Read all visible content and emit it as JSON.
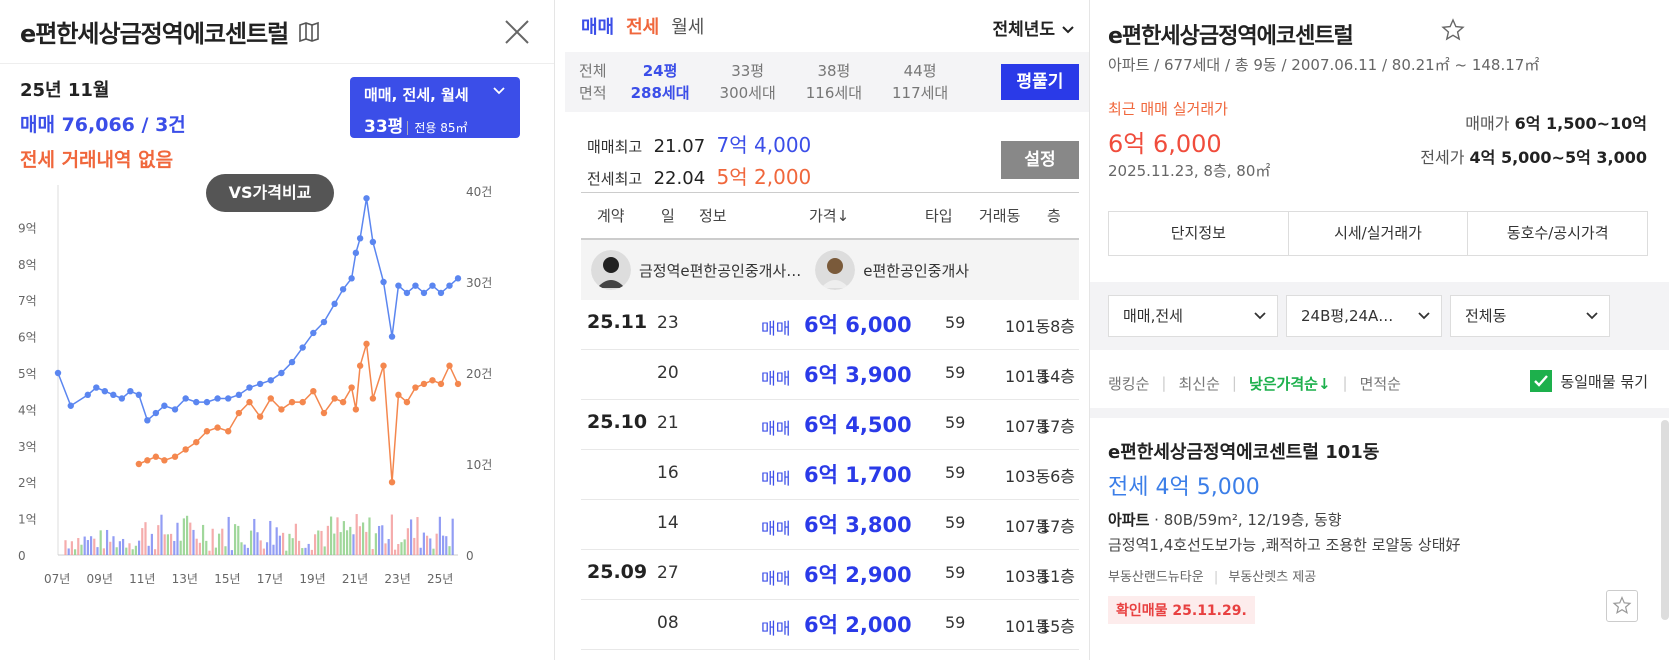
{
  "left": {
    "title": "e편한세상금정역에코센트럴",
    "month": "25년 11월",
    "sale_summary": "매매 76,066 / 3건",
    "jeonse_summary": "전세 거래내역 없음",
    "type_box": {
      "types": "매매, 전세, 월세",
      "size": "33평",
      "area": "전용 85㎡"
    },
    "vs_button": "VS가격비교"
  },
  "chart_data": {
    "type": "line",
    "y_left_ticks": [
      "0",
      "1억",
      "2억",
      "3억",
      "4억",
      "5억",
      "6억",
      "7억",
      "8억",
      "9억"
    ],
    "y_right_ticks": [
      "0",
      "10건",
      "20건",
      "30건",
      "40건"
    ],
    "x_ticks": [
      "07년",
      "09년",
      "11년",
      "13년",
      "15년",
      "17년",
      "19년",
      "21년",
      "23년",
      "25년"
    ],
    "ylim_left": [
      0,
      10
    ],
    "ylim_right": [
      0,
      40
    ],
    "series": [
      {
        "color": "#5b86f0",
        "x": [
          2007.0,
          2007.6,
          2008.4,
          2008.8,
          2009.2,
          2009.6,
          2010.0,
          2010.4,
          2010.8,
          2011.2,
          2011.6,
          2012.0,
          2012.5,
          2013.0,
          2013.5,
          2014.0,
          2014.5,
          2015.0,
          2015.5,
          2016.0,
          2016.5,
          2017.0,
          2017.5,
          2018.0,
          2018.5,
          2019.0,
          2019.5,
          2020.0,
          2020.4,
          2020.8,
          2021.0,
          2021.2,
          2021.5,
          2021.8,
          2022.3,
          2022.7,
          2023.0,
          2023.4,
          2023.8,
          2024.2,
          2024.6,
          2025.0,
          2025.4,
          2025.8
        ],
        "values": [
          5.0,
          4.1,
          4.4,
          4.6,
          4.5,
          4.4,
          4.3,
          4.5,
          4.4,
          3.7,
          3.9,
          4.1,
          4.0,
          4.3,
          4.2,
          4.2,
          4.3,
          4.3,
          4.4,
          4.6,
          4.7,
          4.8,
          5.0,
          5.3,
          5.7,
          6.1,
          6.4,
          6.9,
          7.3,
          7.6,
          8.3,
          8.7,
          9.8,
          8.6,
          7.5,
          6.0,
          7.4,
          7.2,
          7.4,
          7.2,
          7.4,
          7.2,
          7.4,
          7.6
        ]
      },
      {
        "color": "#f4874e",
        "x": [
          2010.8,
          2011.2,
          2011.6,
          2012.0,
          2012.5,
          2013.0,
          2013.5,
          2014.0,
          2014.5,
          2015.0,
          2015.5,
          2016.0,
          2016.5,
          2017.0,
          2017.5,
          2018.0,
          2018.5,
          2019.0,
          2019.5,
          2020.0,
          2020.4,
          2020.8,
          2021.0,
          2021.2,
          2021.5,
          2021.8,
          2022.3,
          2022.7,
          2023.0,
          2023.4,
          2023.8,
          2024.2,
          2024.6,
          2025.0,
          2025.4,
          2025.8
        ],
        "values": [
          2.5,
          2.6,
          2.7,
          2.6,
          2.7,
          2.9,
          3.1,
          3.4,
          3.5,
          3.4,
          3.9,
          4.2,
          3.8,
          4.3,
          4.0,
          4.2,
          4.2,
          4.5,
          3.9,
          4.3,
          4.2,
          4.6,
          4.0,
          5.2,
          5.8,
          4.3,
          5.2,
          2.0,
          4.4,
          4.2,
          4.6,
          4.7,
          4.8,
          4.7,
          5.2,
          4.7
        ]
      }
    ]
  },
  "mid": {
    "tabs": [
      "매매",
      "전세",
      "월세"
    ],
    "year_select": "전체년도",
    "sizes": [
      {
        "top": "전체",
        "bottom": "면적"
      },
      {
        "top": "24평",
        "bottom": "288세대"
      },
      {
        "top": "33평",
        "bottom": "300세대"
      },
      {
        "top": "38평",
        "bottom": "116세대"
      },
      {
        "top": "44평",
        "bottom": "117세대"
      }
    ],
    "pyeong_button": "평풀기",
    "sale_max": {
      "label": "매매최고",
      "date": "21.07",
      "price": "7억 4,000"
    },
    "jeonse_max": {
      "label": "전세최고",
      "date": "22.04",
      "price": "5억 2,000"
    },
    "set_button": "설정",
    "headers": [
      "계약",
      "일",
      "정보",
      "가격↓",
      "타입",
      "거래동",
      "층"
    ],
    "agent1": "금정역e편한공인중개사…",
    "agent2": "e편한공인중개사",
    "rows": [
      {
        "ym": "25.11",
        "day": "23",
        "kind": "매매",
        "price": "6억 6,000",
        "type": "59",
        "dong": "101동",
        "floor": "8층"
      },
      {
        "ym": "",
        "day": "20",
        "kind": "매매",
        "price": "6억 3,900",
        "type": "59",
        "dong": "101동",
        "floor": "14층"
      },
      {
        "ym": "25.10",
        "day": "21",
        "kind": "매매",
        "price": "6억 4,500",
        "type": "59",
        "dong": "107동",
        "floor": "17층"
      },
      {
        "ym": "",
        "day": "16",
        "kind": "매매",
        "price": "6억 1,700",
        "type": "59",
        "dong": "103동",
        "floor": "6층"
      },
      {
        "ym": "",
        "day": "14",
        "kind": "매매",
        "price": "6억 3,800",
        "type": "59",
        "dong": "107동",
        "floor": "17층"
      },
      {
        "ym": "25.09",
        "day": "27",
        "kind": "매매",
        "price": "6억 2,900",
        "type": "59",
        "dong": "103동",
        "floor": "11층"
      },
      {
        "ym": "",
        "day": "08",
        "kind": "매매",
        "price": "6억 2,000",
        "type": "59",
        "dong": "101동",
        "floor": "15층"
      }
    ]
  },
  "right": {
    "title": "e편한세상금정역에코센트럴",
    "info": "아파트 / 677세대 / 총 9동 / 2007.06.11 / 80.21㎡ ~ 148.17㎡",
    "recent_label": "최근 매매 실거래가",
    "recent_price": "6억 6,000",
    "recent_date": "2025.11.23, 8층, 80㎡",
    "range_sale_label": "매매가",
    "range_sale": "6억 1,500~10억",
    "range_jeonse_label": "전세가",
    "range_jeonse": "4억 5,000~5억 3,000",
    "buttons": [
      "단지정보",
      "시세/실거래가",
      "동호수/공시가격"
    ],
    "selects": [
      "매매,전세",
      "24B평,24A…",
      "전체동"
    ],
    "sorts": [
      "랭킹순",
      "최신순",
      "낮은가격순↓",
      "면적순"
    ],
    "group_check": "동일매물 묶기",
    "card": {
      "title": "e편한세상금정역에코센트럴 101동",
      "price": "전세 4억 5,000",
      "spec_bold": "아파트",
      "spec": " · 80B/59m², 12/19층, 동향",
      "desc": "금정역1,4호선도보가능 ,쾌적하고 조용한 로얄동 상태好",
      "src1": "부동산랜드뉴타운",
      "src2": "부동산렛츠 제공",
      "badge": "확인매물 25.11.29."
    }
  }
}
